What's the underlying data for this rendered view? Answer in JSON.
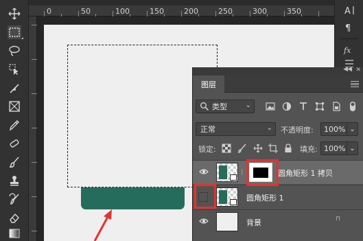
{
  "ruler": {
    "marks": [
      "0",
      "50",
      "100",
      "150",
      "200",
      "250",
      "300",
      "350"
    ]
  },
  "toolbar": {
    "tools": [
      "move-icon",
      "marquee-icon",
      "lasso-icon",
      "quick-select-icon",
      "crop-icon",
      "frame-icon",
      "eyedropper-icon",
      "healing-icon",
      "brush-icon",
      "stamp-icon",
      "history-brush-icon",
      "eraser-icon",
      "gradient-icon"
    ]
  },
  "side_strip": {
    "icons": [
      "character-icon",
      "paragraph-icon",
      "fx-icon",
      "properties-icon"
    ]
  },
  "layers_panel": {
    "tab_label": "图层",
    "filter": {
      "label": "类型"
    },
    "blend_mode": "正常",
    "opacity_label": "不透明度:",
    "opacity_value": "100%",
    "lock_label": "锁定:",
    "fill_label": "填充:",
    "fill_value": "100%",
    "layers": [
      {
        "name": "圆角矩形 1 拷贝",
        "visible": true,
        "selected": true,
        "has_mask": true
      },
      {
        "name": "圆角矩形 1",
        "visible": false,
        "selected": false,
        "has_mask": false
      },
      {
        "name": "背景",
        "visible": true,
        "selected": false,
        "has_mask": false
      }
    ]
  },
  "colors": {
    "shape_fill": "#266c5c",
    "highlight": "#e5322d",
    "canvas": "#efefef"
  }
}
